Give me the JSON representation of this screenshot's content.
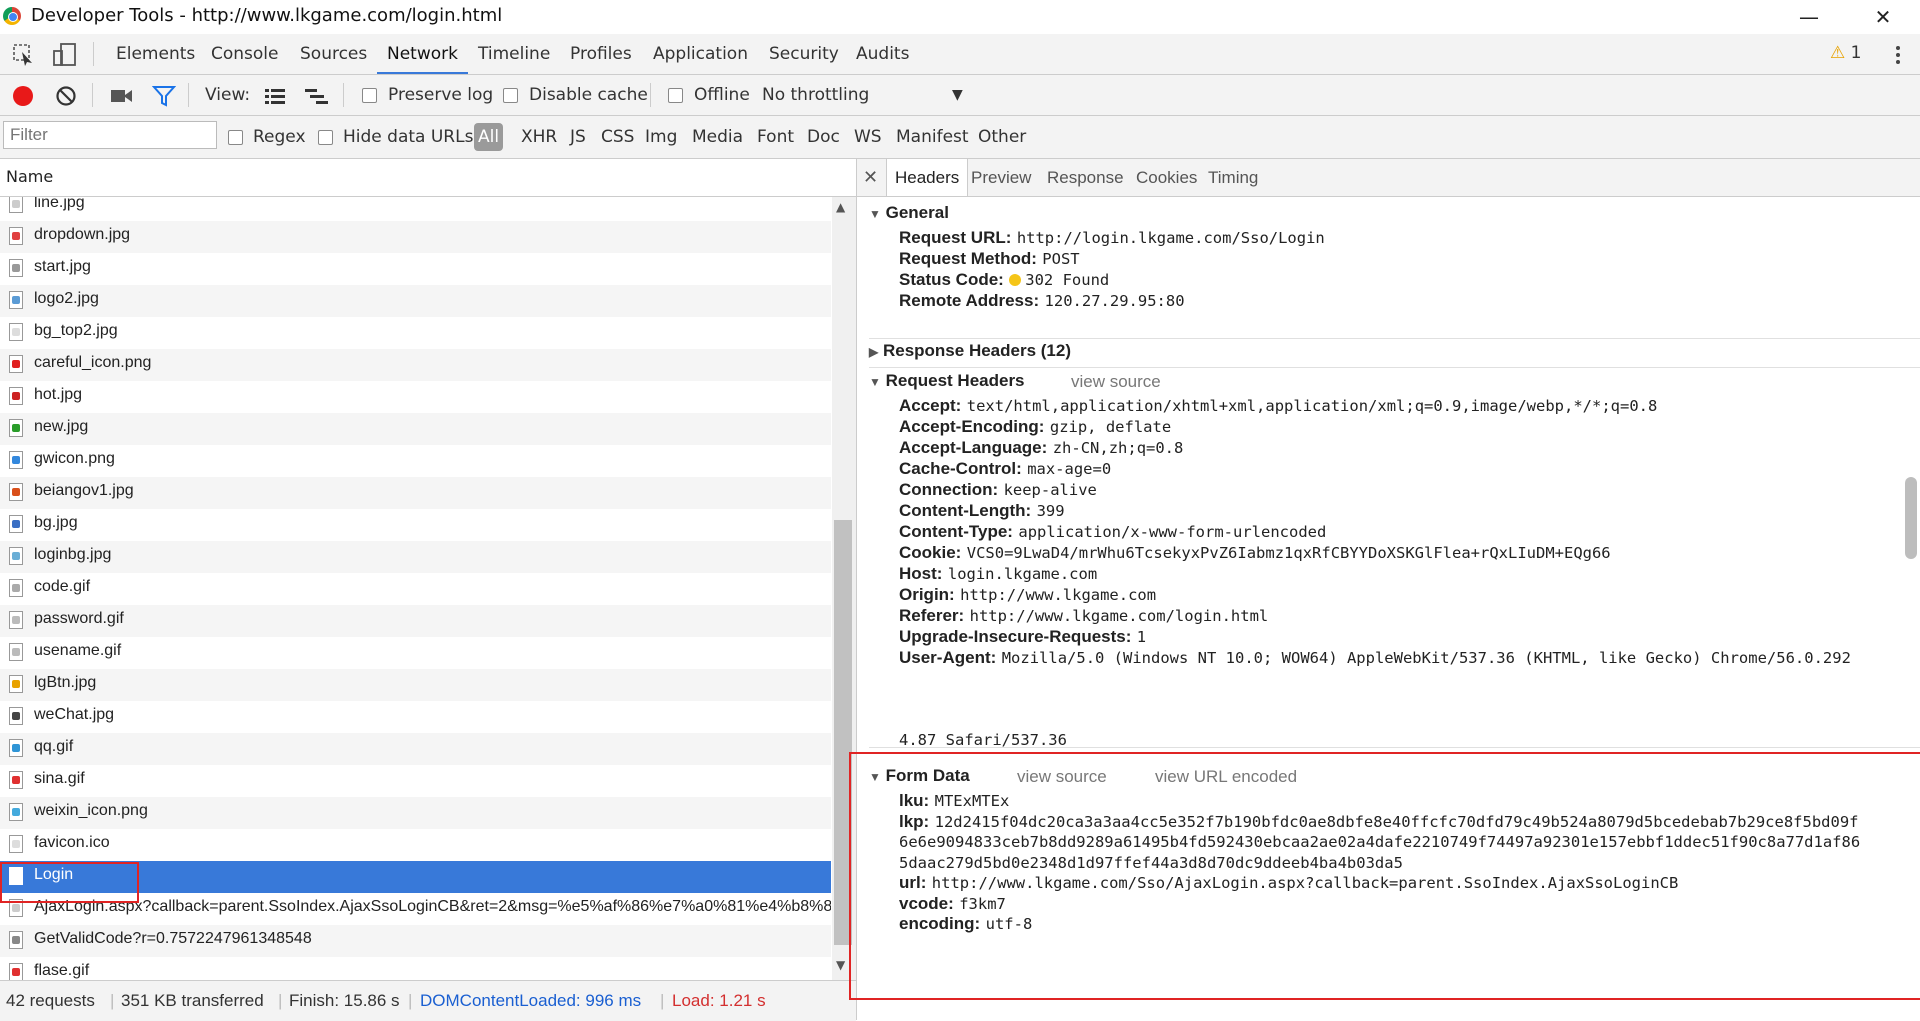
{
  "window": {
    "title": "Developer Tools - http://www.lkgame.com/login.html",
    "minimize": "—",
    "restore": "❐",
    "close": "✕"
  },
  "panels": [
    "Elements",
    "Console",
    "Sources",
    "Network",
    "Timeline",
    "Profiles",
    "Application",
    "Security",
    "Audits"
  ],
  "active_panel": "Network",
  "warnings": {
    "count": "1"
  },
  "toolbar": {
    "view_label": "View:",
    "preserve_log": "Preserve log",
    "disable_cache": "Disable cache",
    "offline": "Offline",
    "throttling": "No throttling"
  },
  "filter": {
    "placeholder": "Filter",
    "regex": "Regex",
    "hide_data_urls": "Hide data URLs",
    "types": [
      "All",
      "XHR",
      "JS",
      "CSS",
      "Img",
      "Media",
      "Font",
      "Doc",
      "WS",
      "Manifest",
      "Other"
    ],
    "active_type": "All"
  },
  "list": {
    "header": "Name",
    "items": [
      {
        "name": "line.jpg",
        "icon": "#cccccc"
      },
      {
        "name": "dropdown.jpg",
        "icon": "#e04040"
      },
      {
        "name": "start.jpg",
        "icon": "#999999"
      },
      {
        "name": "logo2.jpg",
        "icon": "#5b9bd5"
      },
      {
        "name": "bg_top2.jpg",
        "icon": "#dddddd"
      },
      {
        "name": "careful_icon.png",
        "icon": "#e02020"
      },
      {
        "name": "hot.jpg",
        "icon": "#cc2222"
      },
      {
        "name": "new.jpg",
        "icon": "#2a9d2a"
      },
      {
        "name": "gwicon.png",
        "icon": "#3388dd"
      },
      {
        "name": "beiangov1.jpg",
        "icon": "#d94f1a"
      },
      {
        "name": "bg.jpg",
        "icon": "#3a6fc4"
      },
      {
        "name": "loginbg.jpg",
        "icon": "#6aaed6"
      },
      {
        "name": "code.gif",
        "icon": "#aaaaaa"
      },
      {
        "name": "password.gif",
        "icon": "#bbbbbb"
      },
      {
        "name": "usename.gif",
        "icon": "#bbbbbb"
      },
      {
        "name": "lgBtn.jpg",
        "icon": "#e8a200"
      },
      {
        "name": "weChat.jpg",
        "icon": "#444444"
      },
      {
        "name": "qq.gif",
        "icon": "#2f95d6"
      },
      {
        "name": "sina.gif",
        "icon": "#e03030"
      },
      {
        "name": "weixin_icon.png",
        "icon": "#44aadd"
      },
      {
        "name": "favicon.ico",
        "icon": "#dddddd"
      },
      {
        "name": "Login",
        "icon": "#ffffff",
        "selected": true
      },
      {
        "name": "AjaxLogin.aspx?callback=parent.SsoIndex.AjaxSsoLoginCB&ret=2&msg=%e5%af%86%e7%a0%81%e4%b8%8",
        "icon": "#cccccc"
      },
      {
        "name": "GetValidCode?r=0.7572247961348548",
        "icon": "#888888"
      },
      {
        "name": "flase.gif",
        "icon": "#e03030"
      }
    ]
  },
  "status": {
    "requests": "42 requests",
    "transferred": "351 KB transferred",
    "finish": "Finish: 15.86 s",
    "dom": "DOMContentLoaded: 996 ms",
    "load": "Load: 1.21 s"
  },
  "detail_tabs": [
    "Headers",
    "Preview",
    "Response",
    "Cookies",
    "Timing"
  ],
  "active_detail_tab": "Headers",
  "general": {
    "title": "General",
    "rows": [
      {
        "k": "Request URL:",
        "v": "http://login.lkgame.com/Sso/Login"
      },
      {
        "k": "Request Method:",
        "v": "POST"
      },
      {
        "k": "Status Code:",
        "v": "302 Found"
      },
      {
        "k": "Remote Address:",
        "v": "120.27.29.95:80"
      }
    ]
  },
  "response_headers": {
    "title": "Response Headers (12)"
  },
  "request_headers": {
    "title": "Request Headers",
    "link": "view source",
    "rows": [
      {
        "k": "Accept:",
        "v": "text/html,application/xhtml+xml,application/xml;q=0.9,image/webp,*/*;q=0.8"
      },
      {
        "k": "Accept-Encoding:",
        "v": "gzip, deflate"
      },
      {
        "k": "Accept-Language:",
        "v": "zh-CN,zh;q=0.8"
      },
      {
        "k": "Cache-Control:",
        "v": "max-age=0"
      },
      {
        "k": "Connection:",
        "v": "keep-alive"
      },
      {
        "k": "Content-Length:",
        "v": "399"
      },
      {
        "k": "Content-Type:",
        "v": "application/x-www-form-urlencoded"
      },
      {
        "k": "Cookie:",
        "v": "VCS0=9LwaD4/mrWhu6TcsekyxPvZ6Iabmz1qxRfCBYYDoXSKGlFlea+rQxLIuDM+EQg66"
      },
      {
        "k": "Host:",
        "v": "login.lkgame.com"
      },
      {
        "k": "Origin:",
        "v": "http://www.lkgame.com"
      },
      {
        "k": "Referer:",
        "v": "http://www.lkgame.com/login.html"
      },
      {
        "k": "Upgrade-Insecure-Requests:",
        "v": "1"
      },
      {
        "k": "User-Agent:",
        "v": "Mozilla/5.0 (Windows NT 10.0; WOW64) AppleWebKit/537.36 (KHTML, like Gecko) Chrome/56.0.292"
      }
    ],
    "ua_cont": "4.87 Safari/537.36"
  },
  "form_data": {
    "title": "Form Data",
    "link1": "view source",
    "link2": "view URL encoded",
    "rows": [
      {
        "k": "lku:",
        "v": "MTExMTEx"
      },
      {
        "k": "lkp:",
        "v": "12d2415f04dc20ca3a3aa4cc5e352f7b190bfdc0ae8dbfe8e40ffcfc70dfd79c49b524a8079d5bcedebab7b29ce8f5bd09f"
      },
      {
        "k": "",
        "v": "6e6e9094833ceb7b8dd9289a61495b4fd592430ebcaa2ae02a4dafe2210749f74497a92301e157ebbf1ddec51f90c8a77d1af86"
      },
      {
        "k": "",
        "v": "5daac279d5bd0e2348d1d97ffef44a3d8d70dc9ddeeb4ba4b03da5"
      },
      {
        "k": "url:",
        "v": "http://www.lkgame.com/Sso/AjaxLogin.aspx?callback=parent.SsoIndex.AjaxSsoLoginCB"
      },
      {
        "k": "vcode:",
        "v": "f3km7"
      },
      {
        "k": "encoding:",
        "v": "utf-8"
      }
    ]
  },
  "colors": {
    "accent": "#3879d9",
    "highlight_box": "#e02424",
    "dom_loaded": "#1a5fd1",
    "load": "#d32f2f",
    "record": "#e81919"
  }
}
